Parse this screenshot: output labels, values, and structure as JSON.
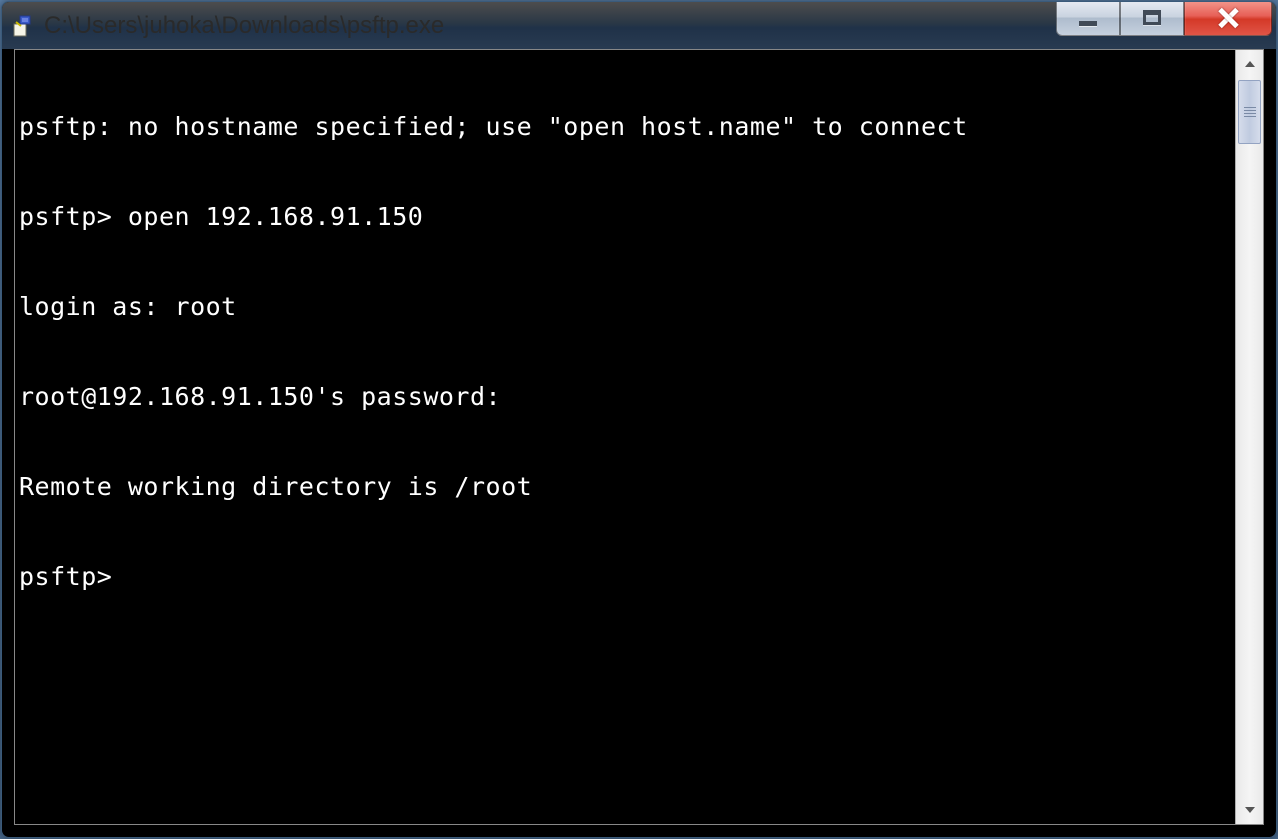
{
  "window": {
    "title": "C:\\Users\\juhoka\\Downloads\\psftp.exe"
  },
  "terminal": {
    "lines": [
      "psftp: no hostname specified; use \"open host.name\" to connect",
      "psftp> open 192.168.91.150",
      "login as: root",
      "root@192.168.91.150's password:",
      "Remote working directory is /root",
      "psftp>"
    ]
  }
}
